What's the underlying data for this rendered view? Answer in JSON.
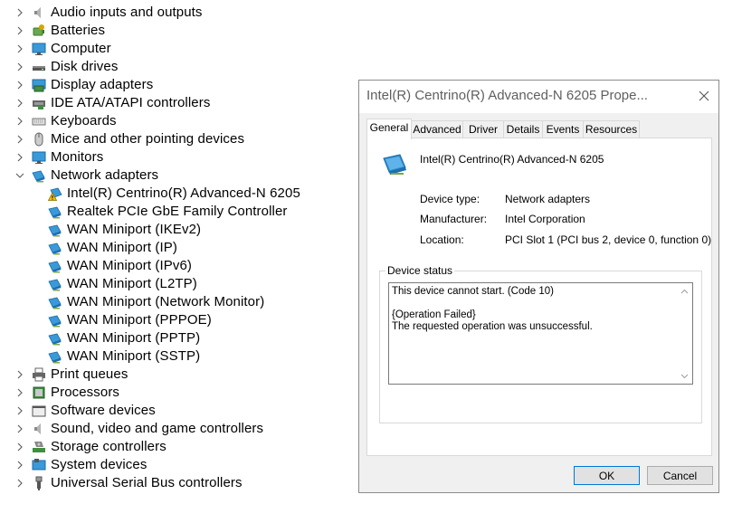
{
  "tree": {
    "items": [
      {
        "label": "Audio inputs and outputs",
        "icon": "speaker-icon",
        "expanded": false,
        "level": 0
      },
      {
        "label": "Batteries",
        "icon": "battery-icon",
        "expanded": false,
        "level": 0
      },
      {
        "label": "Computer",
        "icon": "monitor-icon",
        "expanded": false,
        "level": 0
      },
      {
        "label": "Disk drives",
        "icon": "disk-drive-icon",
        "expanded": false,
        "level": 0
      },
      {
        "label": "Display adapters",
        "icon": "display-adapter-icon",
        "expanded": false,
        "level": 0
      },
      {
        "label": "IDE ATA/ATAPI controllers",
        "icon": "ide-controller-icon",
        "expanded": false,
        "level": 0
      },
      {
        "label": "Keyboards",
        "icon": "keyboard-icon",
        "expanded": false,
        "level": 0
      },
      {
        "label": "Mice and other pointing devices",
        "icon": "mouse-icon",
        "expanded": false,
        "level": 0
      },
      {
        "label": "Monitors",
        "icon": "monitor-icon",
        "expanded": false,
        "level": 0
      },
      {
        "label": "Network adapters",
        "icon": "network-adapter-icon",
        "expanded": true,
        "level": 0
      },
      {
        "label": "Intel(R) Centrino(R) Advanced-N 6205",
        "icon": "network-adapter-warning-icon",
        "level": 1
      },
      {
        "label": "Realtek PCIe GbE Family Controller",
        "icon": "network-adapter-icon",
        "level": 1
      },
      {
        "label": "WAN Miniport (IKEv2)",
        "icon": "network-adapter-icon",
        "level": 1
      },
      {
        "label": "WAN Miniport (IP)",
        "icon": "network-adapter-icon",
        "level": 1
      },
      {
        "label": "WAN Miniport (IPv6)",
        "icon": "network-adapter-icon",
        "level": 1
      },
      {
        "label": "WAN Miniport (L2TP)",
        "icon": "network-adapter-icon",
        "level": 1
      },
      {
        "label": "WAN Miniport (Network Monitor)",
        "icon": "network-adapter-icon",
        "level": 1
      },
      {
        "label": "WAN Miniport (PPPOE)",
        "icon": "network-adapter-icon",
        "level": 1
      },
      {
        "label": "WAN Miniport (PPTP)",
        "icon": "network-adapter-icon",
        "level": 1
      },
      {
        "label": "WAN Miniport (SSTP)",
        "icon": "network-adapter-icon",
        "level": 1
      },
      {
        "label": "Print queues",
        "icon": "printer-icon",
        "expanded": false,
        "level": 0
      },
      {
        "label": "Processors",
        "icon": "processor-icon",
        "expanded": false,
        "level": 0
      },
      {
        "label": "Software devices",
        "icon": "software-device-icon",
        "expanded": false,
        "level": 0
      },
      {
        "label": "Sound, video and game controllers",
        "icon": "speaker-icon",
        "expanded": false,
        "level": 0
      },
      {
        "label": "Storage controllers",
        "icon": "storage-controller-icon",
        "expanded": false,
        "level": 0
      },
      {
        "label": "System devices",
        "icon": "system-device-icon",
        "expanded": false,
        "level": 0
      },
      {
        "label": "Universal Serial Bus controllers",
        "icon": "usb-icon",
        "expanded": false,
        "level": 0
      }
    ]
  },
  "dialog": {
    "title": "Intel(R) Centrino(R) Advanced-N 6205 Prope...",
    "tabs": [
      "General",
      "Advanced",
      "Driver",
      "Details",
      "Events",
      "Resources"
    ],
    "active_tab": "General",
    "device_name": "Intel(R) Centrino(R) Advanced-N 6205",
    "properties": [
      {
        "key": "Device type:",
        "value": "Network adapters"
      },
      {
        "key": "Manufacturer:",
        "value": "Intel Corporation"
      },
      {
        "key": "Location:",
        "value": "PCI Slot 1 (PCI bus 2, device 0, function 0)"
      }
    ],
    "status_group_label": "Device status",
    "status_lines": [
      "This device cannot start. (Code 10)",
      "",
      "{Operation Failed}",
      "The requested operation was unsuccessful."
    ],
    "ok_label": "OK",
    "cancel_label": "Cancel"
  },
  "colors": {
    "accent": "#0078d7",
    "adapter_blue": "#3a9ad9",
    "warning_yellow": "#f2c200"
  }
}
